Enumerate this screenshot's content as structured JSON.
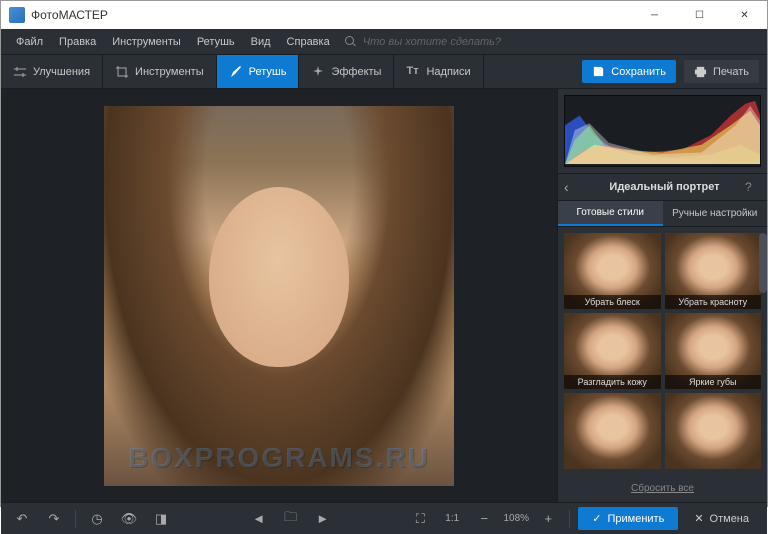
{
  "window": {
    "title": "ФотоМАСТЕР"
  },
  "menu": {
    "file": "Файл",
    "edit": "Правка",
    "tools": "Инструменты",
    "retouch": "Ретушь",
    "view": "Вид",
    "help": "Справка",
    "search_placeholder": "Что вы хотите сделать?"
  },
  "toolbar": {
    "tabs": {
      "enhance": "Улучшения",
      "tools": "Инструменты",
      "retouch": "Ретушь",
      "effects": "Эффекты",
      "text": "Надписи"
    },
    "save": "Сохранить",
    "print": "Печать"
  },
  "panel": {
    "title": "Идеальный портрет",
    "tab_presets": "Готовые стили",
    "tab_manual": "Ручные настройки",
    "reset": "Сбросить все"
  },
  "presets": [
    {
      "label": "Убрать блеск"
    },
    {
      "label": "Убрать красноту"
    },
    {
      "label": "Разгладить кожу"
    },
    {
      "label": "Яркие губы"
    },
    {
      "label": ""
    },
    {
      "label": ""
    }
  ],
  "status": {
    "ratio": "1:1",
    "zoom": "108%",
    "apply": "Применить",
    "cancel": "Отмена"
  },
  "watermark": "BOXPROGRAMS.RU"
}
